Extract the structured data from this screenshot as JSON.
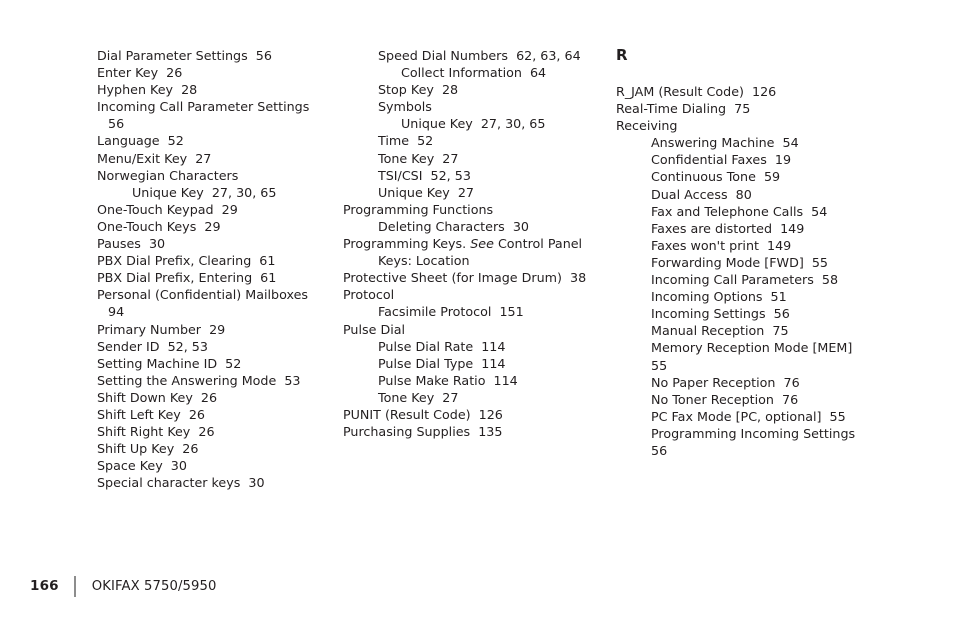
{
  "document": {
    "type": "index-page",
    "background_color": "#ffffff",
    "text_color": "#231f20"
  },
  "columns": [
    {
      "id": "column-1",
      "heading": null,
      "entries": [
        {
          "text": "Dial Parameter Settings  56",
          "level": 0
        },
        {
          "text": "Enter Key  26",
          "level": 0
        },
        {
          "text": "Hyphen Key  28",
          "level": 0
        },
        {
          "text": "Incoming Call Parameter Settings",
          "level": 0
        },
        {
          "text": "56",
          "level": 0,
          "continuation": 0
        },
        {
          "text": "Language  52",
          "level": 0
        },
        {
          "text": "Menu/Exit Key  27",
          "level": 0
        },
        {
          "text": "Norwegian Characters",
          "level": 0
        },
        {
          "text": "Unique Key  27, 30, 65",
          "level": 1
        },
        {
          "text": "One-Touch Keypad  29",
          "level": 0
        },
        {
          "text": "One-Touch Keys  29",
          "level": 0
        },
        {
          "text": "Pauses  30",
          "level": 0
        },
        {
          "text": "PBX Dial Prefix, Clearing  61",
          "level": 0
        },
        {
          "text": "PBX Dial Prefix, Entering  61",
          "level": 0
        },
        {
          "text": "Personal (Confidential) Mailboxes",
          "level": 0
        },
        {
          "text": "94",
          "level": 0,
          "continuation": 0
        },
        {
          "text": "Primary Number  29",
          "level": 0
        },
        {
          "text": "Sender ID  52, 53",
          "level": 0
        },
        {
          "text": "Setting Machine ID  52",
          "level": 0
        },
        {
          "text": "Setting the Answering Mode  53",
          "level": 0
        },
        {
          "text": "Shift Down Key  26",
          "level": 0
        },
        {
          "text": "Shift Left Key  26",
          "level": 0
        },
        {
          "text": "Shift Right Key  26",
          "level": 0
        },
        {
          "text": "Shift Up Key  26",
          "level": 0
        },
        {
          "text": "Space Key  30",
          "level": 0
        },
        {
          "text": "Special character keys  30",
          "level": 0
        }
      ]
    },
    {
      "id": "column-2",
      "heading": null,
      "entries": [
        {
          "text": "Speed Dial Numbers  62, 63, 64",
          "level": 1
        },
        {
          "text": "Collect Information  64",
          "level": 2
        },
        {
          "text": "Stop Key  28",
          "level": 1
        },
        {
          "text": "Symbols",
          "level": 1
        },
        {
          "text": "Unique Key  27, 30, 65",
          "level": 2
        },
        {
          "text": "Time  52",
          "level": 1
        },
        {
          "text": "Tone Key  27",
          "level": 1
        },
        {
          "text": "TSI/CSI  52, 53",
          "level": 1
        },
        {
          "text": "Unique Key  27",
          "level": 1
        },
        {
          "text": "Programming Functions",
          "level": 0
        },
        {
          "text": "Deleting Characters  30",
          "level": 1
        },
        {
          "text": "Programming Keys. ",
          "level": 0,
          "italic_word": "See",
          "text_after": " Control Panel"
        },
        {
          "text": "Keys: Location",
          "level": 0,
          "continuation": 1
        },
        {
          "text": "Protective Sheet (for Image Drum)  38",
          "level": 0
        },
        {
          "text": "Protocol",
          "level": 0
        },
        {
          "text": "Facsimile Protocol  151",
          "level": 1
        },
        {
          "text": "Pulse Dial",
          "level": 0
        },
        {
          "text": "Pulse Dial Rate  114",
          "level": 1
        },
        {
          "text": "Pulse Dial Type  114",
          "level": 1
        },
        {
          "text": "Pulse Make Ratio  114",
          "level": 1
        },
        {
          "text": "Tone Key  27",
          "level": 1
        },
        {
          "text": "PUNIT (Result Code)  126",
          "level": 0
        },
        {
          "text": "Purchasing Supplies  135",
          "level": 0
        }
      ]
    },
    {
      "id": "column-3",
      "heading": "R",
      "entries": [
        {
          "text": "R_JAM (Result Code)  126",
          "level": 0
        },
        {
          "text": "Real-Time Dialing  75",
          "level": 0
        },
        {
          "text": "Receiving",
          "level": 0
        },
        {
          "text": "Answering Machine  54",
          "level": 1
        },
        {
          "text": "Confidential Faxes  19",
          "level": 1
        },
        {
          "text": "Continuous Tone  59",
          "level": 1
        },
        {
          "text": "Dual Access  80",
          "level": 1
        },
        {
          "text": "Fax and Telephone Calls  54",
          "level": 1
        },
        {
          "text": "Faxes are distorted  149",
          "level": 1
        },
        {
          "text": "Faxes won't print  149",
          "level": 1
        },
        {
          "text": "Forwarding Mode [FWD]  55",
          "level": 1
        },
        {
          "text": "Incoming Call Parameters  58",
          "level": 1
        },
        {
          "text": "Incoming Options  51",
          "level": 1
        },
        {
          "text": "Incoming Settings  56",
          "level": 1
        },
        {
          "text": "Manual Reception  75",
          "level": 1
        },
        {
          "text": "Memory Reception Mode [MEM]",
          "level": 1
        },
        {
          "text": "55",
          "level": 1,
          "continuation": 1
        },
        {
          "text": "No Paper Reception  76",
          "level": 1
        },
        {
          "text": "No Toner Reception  76",
          "level": 1
        },
        {
          "text": "PC Fax Mode [PC, optional]  55",
          "level": 1
        },
        {
          "text": "Programming Incoming Settings",
          "level": 1
        },
        {
          "text": "56",
          "level": 1,
          "continuation": 1
        }
      ]
    }
  ],
  "footer": {
    "page_number": "166",
    "title": "OKIFAX 5750/5950",
    "rule_color": "#8d8d8d"
  }
}
